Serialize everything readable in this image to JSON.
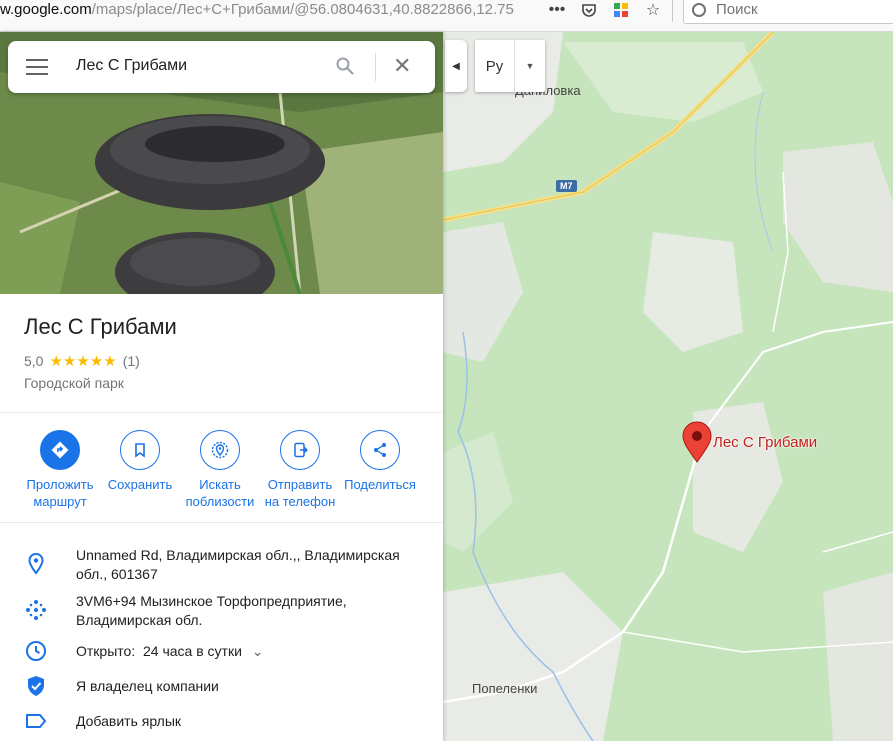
{
  "browser": {
    "url_host": "w.google.com",
    "url_path": "/maps/place/Лес+С+Грибами/@56.0804631,40.8822866,12.75",
    "search_placeholder": "Поиск"
  },
  "map": {
    "labels": {
      "village_top": "Даниловка",
      "village_bottom": "Попеленки",
      "road": "M7",
      "pin": "Лес С Грибами"
    },
    "layer_button_label": "Ру"
  },
  "panel": {
    "search": {
      "value": "Лес С Грибами"
    },
    "title": "Лес С Грибами",
    "rating": {
      "score": "5,0",
      "stars": "★★★★★",
      "count": "(1)",
      "value": 5
    },
    "category": "Городской парк",
    "actions": [
      {
        "label_1": "Проложить",
        "label_2": "маршрут"
      },
      {
        "label_1": "Сохранить",
        "label_2": ""
      },
      {
        "label_1": "Искать",
        "label_2": "поблизости"
      },
      {
        "label_1": "Отправить",
        "label_2": "на телефон"
      },
      {
        "label_1": "Поделиться",
        "label_2": ""
      }
    ],
    "info": {
      "address": "Unnamed Rd, Владимирская обл.,, Владимирская обл., 601367",
      "plus_code": "3VM6+94 Мызинское Торфопредприятие, Владимирская обл.",
      "hours_prefix": "Открыто:",
      "hours_value": "24 часа в сутки",
      "owner": "Я владелец компании",
      "label": "Добавить ярлык"
    }
  },
  "colors": {
    "accent": "#1a73e8",
    "pin": "#ea4335",
    "map_green": "#c8e6c0"
  }
}
